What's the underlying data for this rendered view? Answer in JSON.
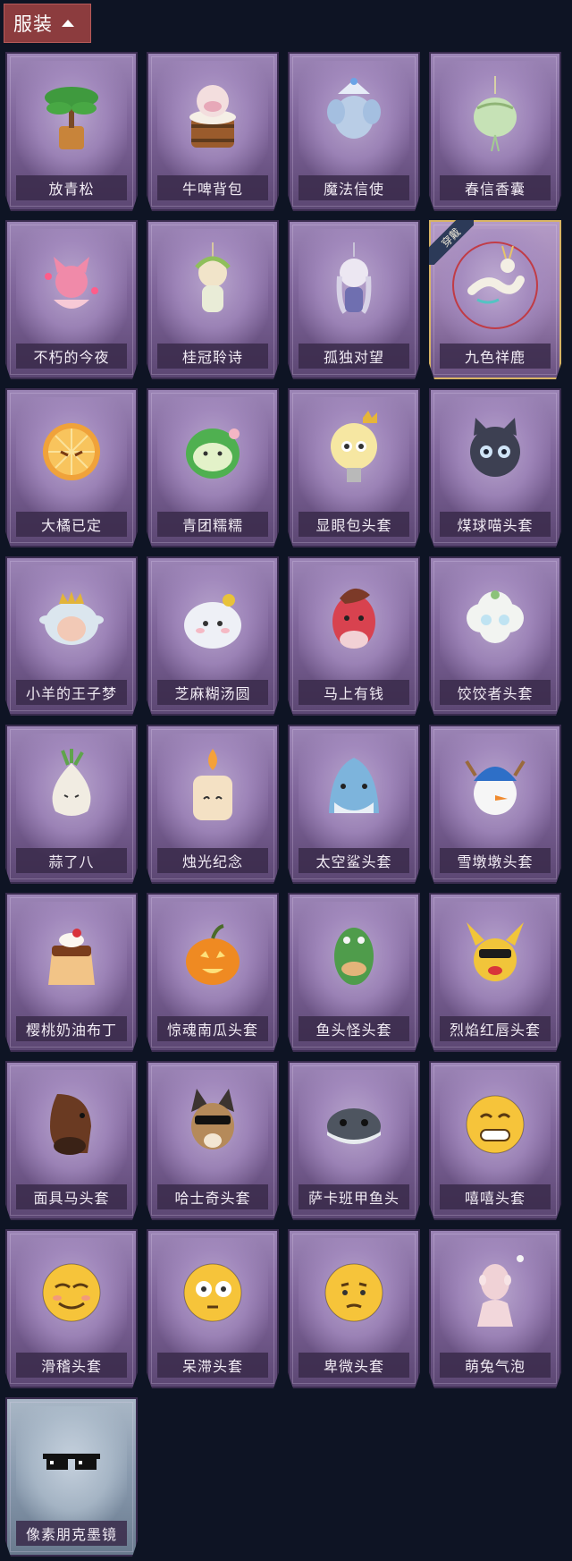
{
  "header": {
    "title": "服装"
  },
  "equipped_badge": "穿戴",
  "items": [
    {
      "name": "放青松",
      "icon": "bonsai-pine-icon"
    },
    {
      "name": "牛啤背包",
      "icon": "cow-beer-barrel-icon"
    },
    {
      "name": "魔法信使",
      "icon": "elephant-messenger-icon"
    },
    {
      "name": "春信香囊",
      "icon": "sachet-icon"
    },
    {
      "name": "不朽的今夜",
      "icon": "pink-fox-icon"
    },
    {
      "name": "桂冠聆诗",
      "icon": "laurel-doll-icon"
    },
    {
      "name": "孤独对望",
      "icon": "lonely-doll-icon"
    },
    {
      "name": "九色祥鹿",
      "icon": "deer-icon",
      "equipped": true
    },
    {
      "name": "大橘已定",
      "icon": "orange-slice-icon"
    },
    {
      "name": "青团糯糯",
      "icon": "green-rice-ball-icon"
    },
    {
      "name": "显眼包头套",
      "icon": "light-bulb-head-icon"
    },
    {
      "name": "煤球喵头套",
      "icon": "black-cat-head-icon"
    },
    {
      "name": "小羊的王子梦",
      "icon": "sheep-prince-icon"
    },
    {
      "name": "芝麻糊汤圆",
      "icon": "dumpling-icon"
    },
    {
      "name": "马上有钱",
      "icon": "red-horse-icon"
    },
    {
      "name": "饺饺者头套",
      "icon": "cloud-dumpling-head-icon"
    },
    {
      "name": "蒜了八",
      "icon": "garlic-icon"
    },
    {
      "name": "烛光纪念",
      "icon": "candle-icon"
    },
    {
      "name": "太空鲨头套",
      "icon": "shark-head-icon"
    },
    {
      "name": "雪墩墩头套",
      "icon": "snowman-head-icon"
    },
    {
      "name": "樱桃奶油布丁",
      "icon": "pudding-icon"
    },
    {
      "name": "惊魂南瓜头套",
      "icon": "pumpkin-head-icon"
    },
    {
      "name": "鱼头怪头套",
      "icon": "fish-head-icon"
    },
    {
      "name": "烈焰红唇头套",
      "icon": "yellow-mouse-head-icon"
    },
    {
      "name": "面具马头套",
      "icon": "horse-mask-icon"
    },
    {
      "name": "哈士奇头套",
      "icon": "husky-head-icon"
    },
    {
      "name": "萨卡班甲鱼头",
      "icon": "sacabambaspis-icon"
    },
    {
      "name": "嘻嘻头套",
      "icon": "grin-emoji-icon"
    },
    {
      "name": "滑稽头套",
      "icon": "funny-emoji-icon"
    },
    {
      "name": "呆滞头套",
      "icon": "dazed-emoji-icon"
    },
    {
      "name": "卑微头套",
      "icon": "humble-emoji-icon"
    },
    {
      "name": "萌兔气泡",
      "icon": "bunny-bubble-icon"
    },
    {
      "name": "像素朋克墨镜",
      "icon": "pixel-sunglasses-icon",
      "frame": "gray"
    }
  ]
}
